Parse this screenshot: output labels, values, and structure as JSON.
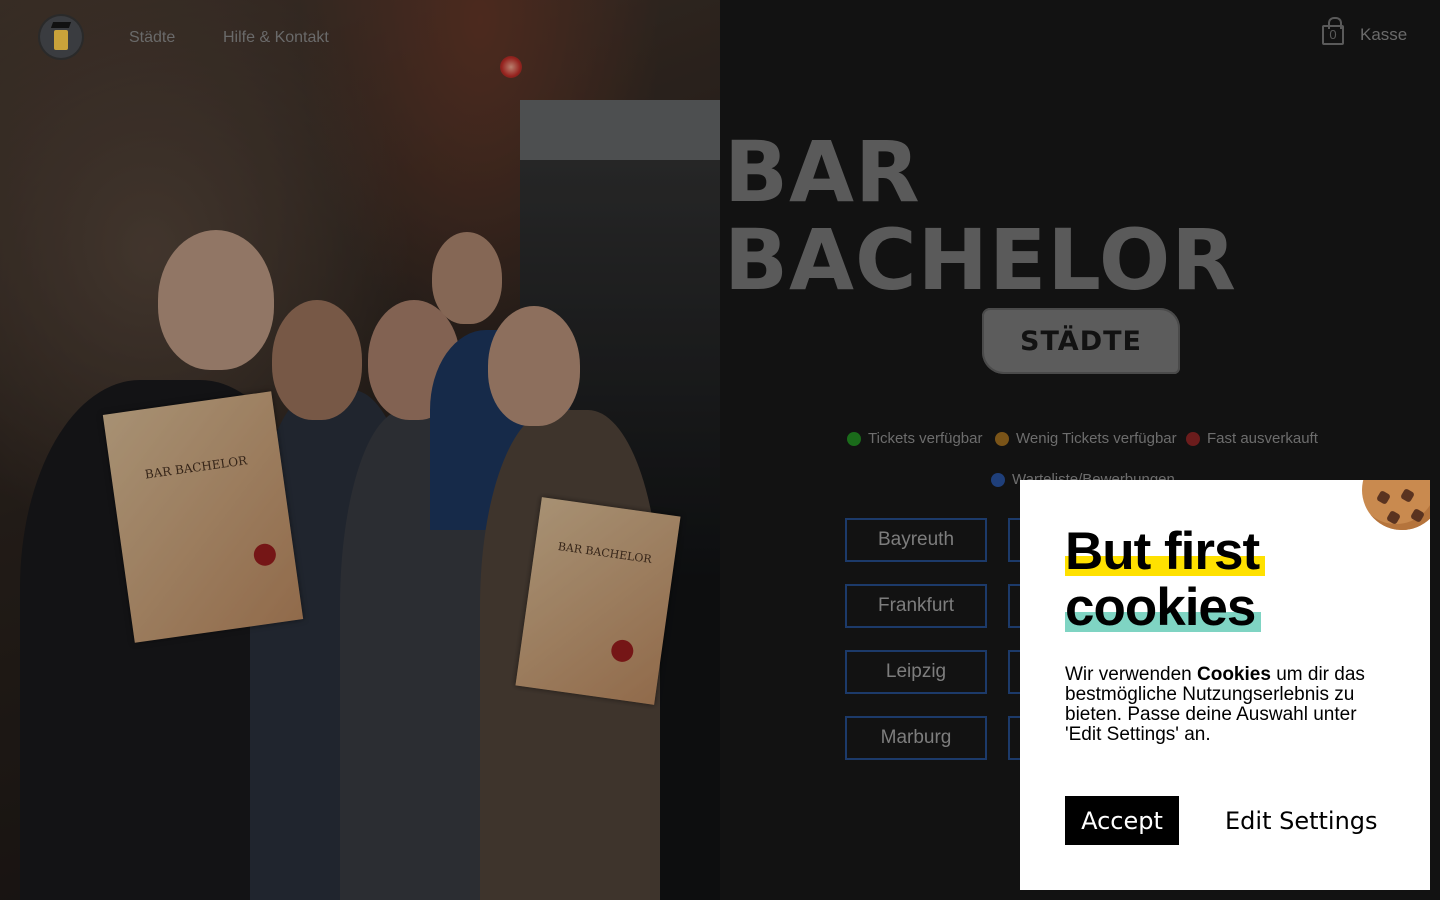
{
  "nav": {
    "links": [
      "Städte",
      "Hilfe & Kontakt"
    ],
    "cart_count": "0",
    "checkout_label": "Kasse"
  },
  "hero": {
    "title_line1": "BAR",
    "title_line2": "BACHELOR",
    "cities_badge": "STÄDTE",
    "certificate_text": "BAR BACHELOR"
  },
  "legend": [
    {
      "label": "Tickets verfügbar",
      "color": "#1a6b1a"
    },
    {
      "label": "Wenig Tickets verfügbar",
      "color": "#7a5418"
    },
    {
      "label": "Fast ausverkauft",
      "color": "#6b1c1c"
    },
    {
      "label": "Warteliste/Bewerbungen",
      "color": "#1f3f7a"
    }
  ],
  "cities": [
    "Bayreuth",
    "Frankfurt",
    "Leipzig",
    "Marburg"
  ],
  "cookie": {
    "title_line1": "But first",
    "title_line2": "cookies",
    "text_before": "Wir verwenden ",
    "text_bold": "Cookies",
    "text_after": " um dir das bestmögliche Nutzungserlebnis zu bieten. Passe deine Auswahl unter 'Edit Settings' an.",
    "accept_label": "Accept",
    "edit_label": "Edit Settings"
  }
}
